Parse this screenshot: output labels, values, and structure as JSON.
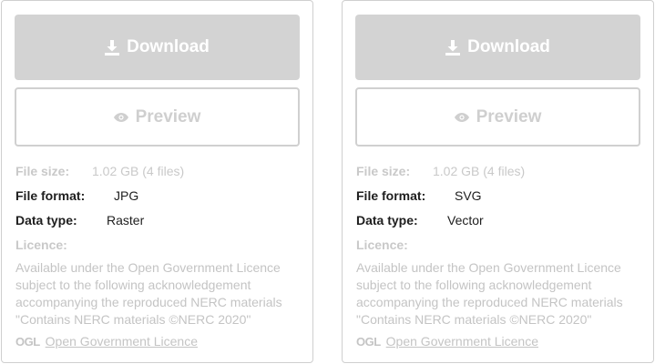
{
  "cards": [
    {
      "download_label": "Download",
      "preview_label": "Preview",
      "file_size_label": "File size:",
      "file_size_value": "1.02 GB (4 files)",
      "file_format_label": "File format:",
      "file_format_value": "JPG",
      "data_type_label": "Data type:",
      "data_type_value": "Raster",
      "licence_label": "Licence:",
      "licence_text": "Available under the Open Government Licence subject to the following acknowledgement accompanying the reproduced NERC materials \"Contains NERC materials ©NERC 2020\"",
      "ogl_logo": "OGL",
      "licence_link": "Open Government Licence"
    },
    {
      "download_label": "Download",
      "preview_label": "Preview",
      "file_size_label": "File size:",
      "file_size_value": "1.02 GB (4 files)",
      "file_format_label": "File format:",
      "file_format_value": "SVG",
      "data_type_label": "Data type:",
      "data_type_value": "Vector",
      "licence_label": "Licence:",
      "licence_text": "Available under the Open Government Licence subject to the following acknowledgement accompanying the reproduced NERC materials \"Contains NERC materials ©NERC 2020\"",
      "ogl_logo": "OGL",
      "licence_link": "Open Government Licence"
    }
  ],
  "icons": {
    "download": "download-icon",
    "preview": "eye-icon"
  },
  "colors": {
    "download_bg": "#d3d3d3",
    "preview_border": "#d0d0d0",
    "muted_text": "#c4c4c4",
    "dark_text": "#1e1e1e"
  }
}
